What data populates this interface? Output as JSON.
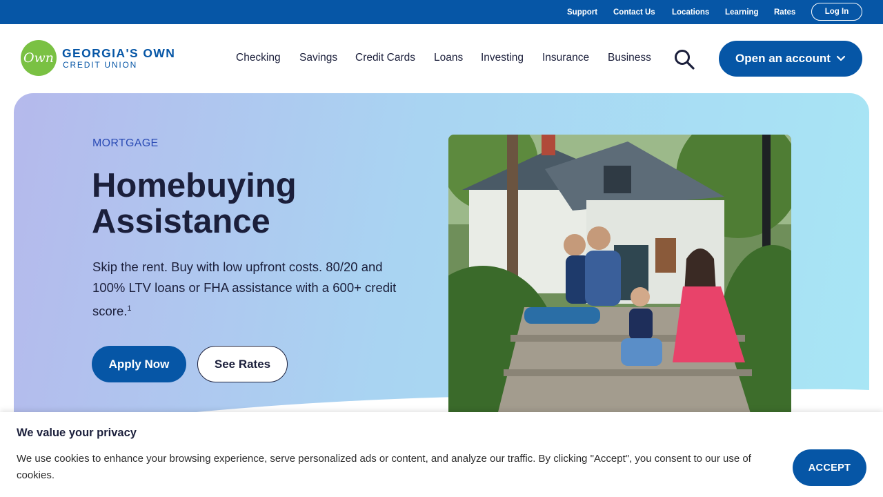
{
  "utility": {
    "links": [
      "Support",
      "Contact Us",
      "Locations",
      "Learning",
      "Rates"
    ],
    "login_label": "Log In"
  },
  "header": {
    "logo_mark": "Own",
    "logo_line1": "GEORGIA'S OWN",
    "logo_line2": "CREDIT UNION",
    "nav": [
      "Checking",
      "Savings",
      "Credit Cards",
      "Loans",
      "Investing",
      "Insurance",
      "Business"
    ],
    "search_icon": "search-icon",
    "open_account_label": "Open an account",
    "open_account_icon": "chevron-down-icon"
  },
  "hero": {
    "eyebrow": "MORTGAGE",
    "title": "Homebuying Assistance",
    "body": "Skip the rent. Buy with low upfront costs. 80/20 and 100% LTV loans or FHA assistance with a 600+ credit score.",
    "footnote": "1",
    "apply_label": "Apply Now",
    "rates_label": "See Rates",
    "photo_alt": "Family sitting on the steps of their home"
  },
  "cookie": {
    "title": "We value your privacy",
    "text": "We use cookies to enhance your browsing experience, serve personalized ads or content, and analyze our traffic. By clicking \"Accept\", you consent to our use of cookies.",
    "accept_label": "ACCEPT"
  },
  "colors": {
    "brand_blue": "#0656a6",
    "logo_green": "#7ac143",
    "text_dark": "#1b1f3b",
    "eyebrow_blue": "#2a4bb5"
  }
}
